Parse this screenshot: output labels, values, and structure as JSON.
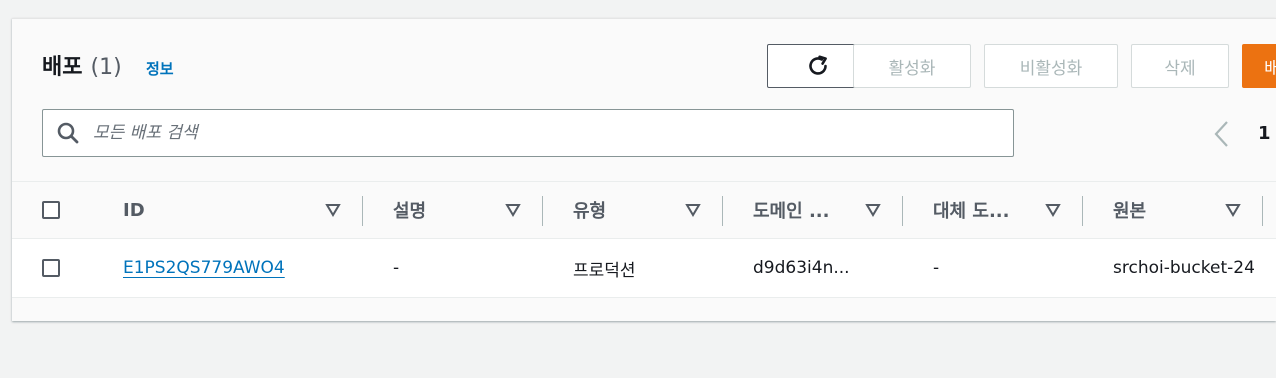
{
  "header": {
    "title": "배포",
    "count": "(1)",
    "info_link": "정보"
  },
  "toolbar": {
    "activate_label": "활성화",
    "deactivate_label": "비활성화",
    "delete_label": "삭제",
    "create_label": "배"
  },
  "search": {
    "placeholder": "모든 배포 검색",
    "value": ""
  },
  "pagination": {
    "current_page": "1"
  },
  "table": {
    "columns": [
      "ID",
      "설명",
      "유형",
      "도메인 ...",
      "대체 도...",
      "원본"
    ],
    "rows": [
      {
        "id": "E1PS2QS779AWO4",
        "description": "-",
        "type": "프로덕션",
        "domain": "d9d63i4n...",
        "alternate_domain": "-",
        "origin": "srchoi-bucket-24"
      }
    ]
  },
  "colors": {
    "link": "#0073bb",
    "primary": "#ec7211",
    "disabled_text": "#aab7b8"
  }
}
